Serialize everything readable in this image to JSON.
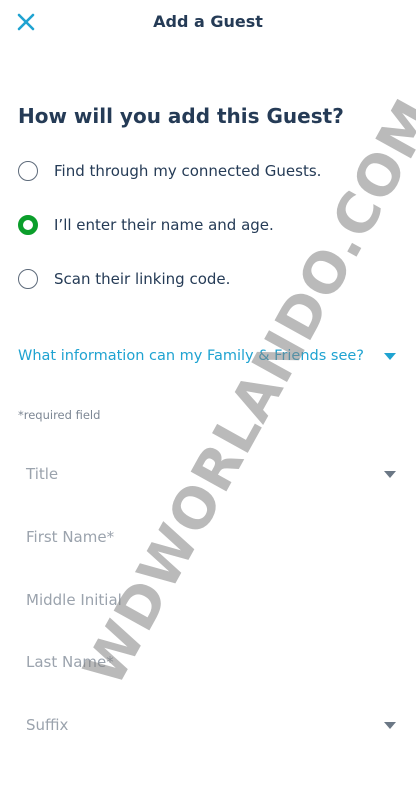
{
  "header": {
    "title": "Add a Guest",
    "close_icon": "close-icon",
    "accent_color": "#1fa3d1"
  },
  "question": "How will you add this Guest?",
  "options": [
    {
      "label": "Find through my connected Guests.",
      "selected": false
    },
    {
      "label": "I’ll enter their name and age.",
      "selected": true
    },
    {
      "label": "Scan their linking code.",
      "selected": false
    }
  ],
  "faq": {
    "label": "What information can my Family & Friends see?",
    "icon": "chevron-down-icon"
  },
  "required_note": "*required field",
  "fields": [
    {
      "placeholder": "Title",
      "type": "dropdown"
    },
    {
      "placeholder": "First Name*",
      "type": "text"
    },
    {
      "placeholder": "Middle Initial",
      "type": "text"
    },
    {
      "placeholder": "Last Name*",
      "type": "text"
    },
    {
      "placeholder": "Suffix",
      "type": "dropdown"
    }
  ],
  "watermark": "WDWORLANDO.COM",
  "colors": {
    "selected_radio": "#0b9e2b",
    "primary_text": "#253b56",
    "link_text": "#1fa3d1"
  }
}
